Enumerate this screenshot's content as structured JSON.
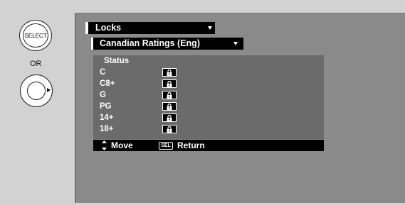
{
  "remote": {
    "select_label": "SELECT",
    "or_label": "OR"
  },
  "menu": {
    "title": "Locks",
    "submenu": "Canadian Ratings (Eng)",
    "status_header": "Status",
    "ratings": [
      {
        "label": "C",
        "lock_icon": "lock-icon"
      },
      {
        "label": "C8+",
        "lock_icon": "lock-icon"
      },
      {
        "label": "G",
        "lock_icon": "lock-icon"
      },
      {
        "label": "PG",
        "lock_icon": "lock-icon"
      },
      {
        "label": "14+",
        "lock_icon": "lock-icon"
      },
      {
        "label": "18+",
        "lock_icon": "lock-icon"
      }
    ]
  },
  "footer": {
    "move_label": "Move",
    "sel_badge": "SEL",
    "return_label": "Return"
  },
  "colors": {
    "background": "#d2d2d2",
    "screen": "#8a8a8a",
    "panel": "#6b6b6b",
    "bar": "#000000",
    "text": "#ffffff"
  }
}
